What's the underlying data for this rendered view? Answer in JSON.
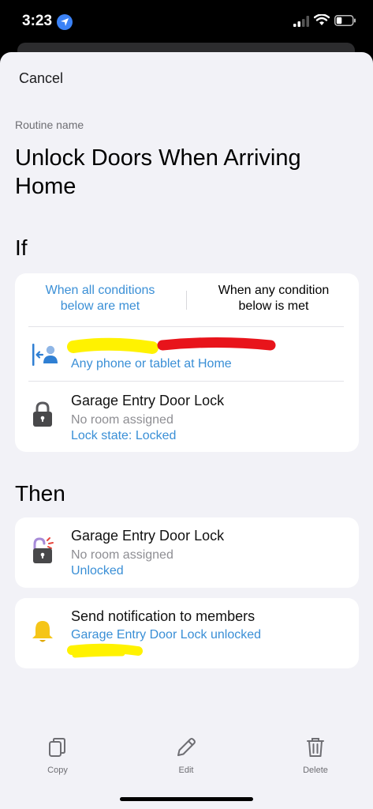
{
  "status_bar": {
    "time": "3:23"
  },
  "sheet": {
    "cancel_label": "Cancel",
    "routine_name_label": "Routine name",
    "routine_name": "Unlock Doors When Arriving Home"
  },
  "if_section": {
    "title": "If",
    "segments": {
      "all": "When all conditions below are met",
      "any": "When any condition below is met"
    },
    "conditions": [
      {
        "icon": "presence-arrival-icon",
        "title": "",
        "link": "Any phone or tablet at Home"
      },
      {
        "icon": "lock-icon",
        "title": "Garage Entry Door Lock",
        "subtitle": "No room assigned",
        "link": "Lock state: Locked"
      }
    ]
  },
  "then_section": {
    "title": "Then",
    "actions": [
      {
        "icon": "unlock-icon",
        "title": "Garage Entry Door Lock",
        "subtitle": "No room assigned",
        "link": "Unlocked"
      },
      {
        "icon": "bell-icon",
        "title": "Send notification to members",
        "link": "Garage Entry Door Lock unlocked"
      }
    ]
  },
  "toolbar": {
    "copy": "Copy",
    "edit": "Edit",
    "delete": "Delete"
  },
  "colors": {
    "accent": "#3a8fd6",
    "highlight_yellow": "#fff200",
    "highlight_red": "#e8141b",
    "bell": "#f5c518"
  }
}
